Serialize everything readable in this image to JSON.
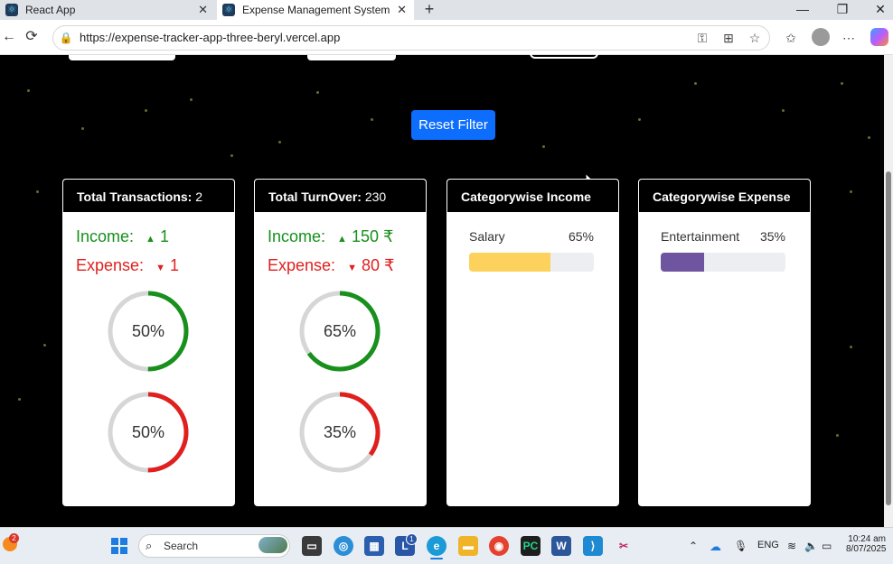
{
  "browser": {
    "tabs": [
      {
        "title": "React App"
      },
      {
        "title": "Expense Management System"
      }
    ],
    "url": "https://expense-tracker-app-three-beryl.vercel.app"
  },
  "page": {
    "reset_button": "Reset Filter",
    "cards": {
      "transactions": {
        "title": "Total Transactions:",
        "value": "2",
        "income_label": "Income:",
        "income_value": "1",
        "expense_label": "Expense:",
        "expense_value": "1",
        "income_percent": 50,
        "income_percent_label": "50%",
        "expense_percent": 50,
        "expense_percent_label": "50%"
      },
      "turnover": {
        "title": "Total TurnOver:",
        "value": "230",
        "income_label": "Income:",
        "income_value": "150",
        "expense_label": "Expense:",
        "expense_value": "80",
        "currency": "₹",
        "income_percent": 65,
        "income_percent_label": "65%",
        "expense_percent": 35,
        "expense_percent_label": "35%"
      },
      "category_income": {
        "title": "Categorywise Income",
        "items": [
          {
            "name": "Salary",
            "percent": 65,
            "percent_label": "65%",
            "color": "#fdd25c"
          }
        ]
      },
      "category_expense": {
        "title": "Categorywise Expense",
        "items": [
          {
            "name": "Entertainment",
            "percent": 35,
            "percent_label": "35%",
            "color": "#6f55a0"
          }
        ]
      }
    }
  },
  "colors": {
    "income": "#17901c",
    "expense": "#e0201e",
    "ring_track": "#d6d6d6",
    "accent": "#0d6efd"
  },
  "taskbar": {
    "search_label": "Search",
    "notification_count": "2",
    "badge_count": "1",
    "language": "ENG",
    "time": "10:24 am",
    "date": "8/07/2025"
  }
}
